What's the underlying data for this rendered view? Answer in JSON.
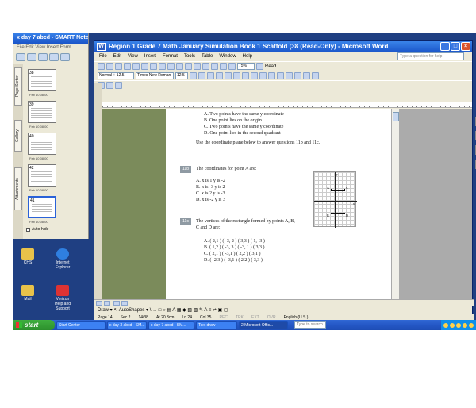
{
  "smart": {
    "title": "x day 7 abcd - SMART Notebook",
    "menu": "File  Edit  View  Insert  Form",
    "tabs": [
      "Page Sorter",
      "Gallery",
      "Attachments"
    ],
    "thumbs": [
      {
        "num": "38",
        "date": "Feb 10 08:00"
      },
      {
        "num": "39",
        "date": "Feb 10 08:00"
      },
      {
        "num": "40",
        "date": "Feb 10 08:00"
      },
      {
        "num": "42",
        "date": "Feb 10 08:00"
      },
      {
        "num": "41",
        "date": "Feb 10 08:00"
      }
    ],
    "autohide": "Auto-hide"
  },
  "desktop_icons": [
    {
      "label": "CHS"
    },
    {
      "label": "Internet Explorer"
    },
    {
      "label": "Mail"
    },
    {
      "label": "Verizon Help and Support"
    }
  ],
  "word": {
    "title": "Region 1 Grade 7 Math January Simulation Book 1 Scaffold (38 (Read-Only) - Microsoft Word",
    "menu": [
      "File",
      "Edit",
      "View",
      "Insert",
      "Format",
      "Tools",
      "Table",
      "Window",
      "Help"
    ],
    "ask": "Type a question for help",
    "zoom": "75%",
    "read_label": "Read",
    "style": "Normal + 12.5",
    "font": "Times New Roman",
    "size": "12.5",
    "draw_label": "Draw",
    "autoshapes_label": "AutoShapes",
    "status": {
      "page": "Page 14",
      "sec": "Sec 2",
      "pages": "14/38",
      "at": "At 20.3cm",
      "ln": "Ln 24",
      "col": "Col 35",
      "rec": "REC",
      "trk": "TRK",
      "ext": "EXT",
      "ovr": "OVR",
      "lang": "English (U.S.)"
    }
  },
  "doc": {
    "answers_top": [
      "A.  Two points have the same y coordinate",
      "B.  One point lies on the origin",
      "C.  Two points have the same y coordinate",
      "D.  One point lies in the second quadrant"
    ],
    "instruction": "Use the coordinate plane below to answer questions 11b and 11c.",
    "q11b_tag": "11b",
    "q11b_text": "The coordinates for point A are:",
    "q11b_choices": [
      "A.  x is 1       y is -2",
      "B.  x is -3      y is 2",
      "C.  x is 2       y is -3",
      "D.  x is -2      y is 3"
    ],
    "q11c_tag": "11c",
    "q11c_text": "The vertices of the rectangle formed by points A, B,",
    "q11c_text2": "C and D are:",
    "q11c_choices": [
      "A.  ( 2,1 ) ( -3, 2 ) ( 3,3 ) ( 1, -3 )",
      "B.  ( 1,2 ) ( -3, 3 ) ( -3, 1 ) ( 3,3 )",
      "C.  ( 2,1 ) ( -3,1 ) ( 2,2 ) ( 3,1 )",
      "D.  ( -2,3 ) ( -3,1 ) ( 2,2 ) ( 3,3 )"
    ],
    "grid_labels": {
      "a": "A",
      "b": "B",
      "c": "C",
      "d": "D",
      "y": "y",
      "x": "x"
    }
  },
  "taskbar": {
    "start": "start",
    "buttons": [
      "Start Center",
      "x day 3 abcd - SM...",
      "x day 7 abcd - SM...",
      "Text draw",
      "2 Microsoft Offic..."
    ],
    "search": "Type to search"
  }
}
